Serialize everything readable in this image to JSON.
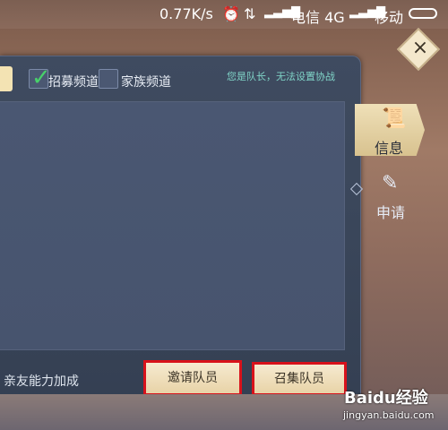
{
  "statusbar": {
    "speed": "0.77K/s",
    "carrier1": "电信 4G",
    "carrier2": "移动"
  },
  "panel": {
    "recruit_channel": "招募频道",
    "family_channel": "家族频道",
    "captain_hint": "您是队长，无法设置协战",
    "bonus_text": "亲友能力加成"
  },
  "buttons": {
    "invite": "邀请队员",
    "gather": "召集队员"
  },
  "side_tabs": {
    "info": "信息",
    "apply": "申请"
  },
  "watermark": {
    "brand": "Baidu经验",
    "url": "jingyan.baidu.com"
  }
}
